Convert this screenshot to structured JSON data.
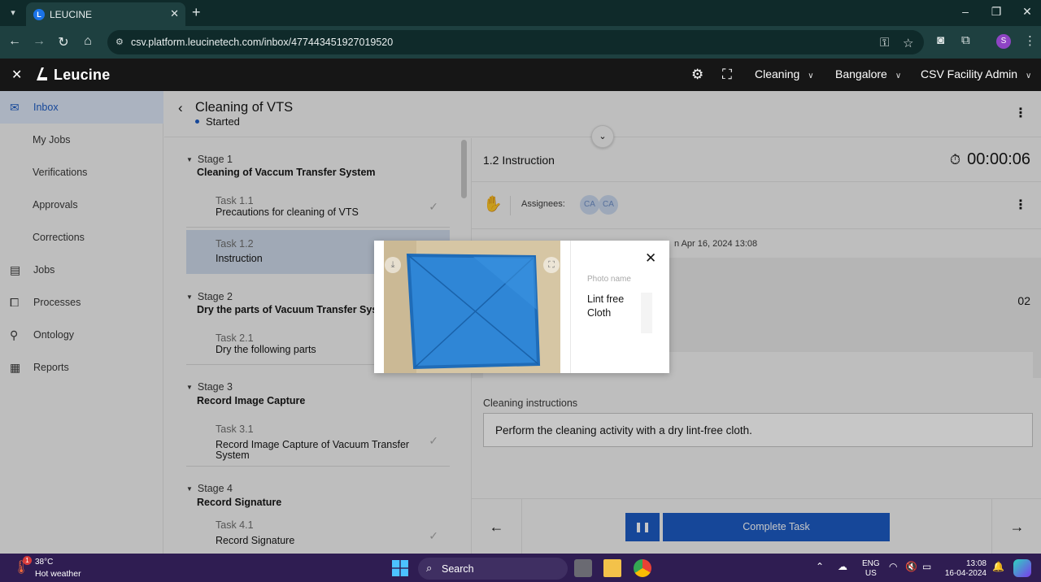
{
  "browser": {
    "tab_title": "LEUCINE",
    "url": "csv.platform.leucinetech.com/inbox/477443451927019520",
    "profile_initial": "S"
  },
  "app": {
    "brand": "Leucine",
    "facility_dropdown": "Cleaning",
    "location_dropdown": "Bangalore",
    "user_dropdown": "CSV Facility Admin"
  },
  "sidebar": {
    "items": [
      {
        "label": "Inbox",
        "icon": "inbox-icon"
      },
      {
        "label": "My Jobs"
      },
      {
        "label": "Verifications"
      },
      {
        "label": "Approvals"
      },
      {
        "label": "Corrections"
      },
      {
        "label": "Jobs",
        "icon": "clipboard-icon"
      },
      {
        "label": "Processes",
        "icon": "flow-icon"
      },
      {
        "label": "Ontology",
        "icon": "hierarchy-icon"
      },
      {
        "label": "Reports",
        "icon": "report-icon"
      }
    ]
  },
  "job": {
    "title": "Cleaning of VTS",
    "status": "Started"
  },
  "stages": [
    {
      "label": "Stage 1",
      "name": "Cleaning of Vaccum Transfer System",
      "tasks": [
        {
          "no": "Task 1.1",
          "name": "Precautions for cleaning of VTS"
        },
        {
          "no": "Task 1.2",
          "name": "Instruction"
        }
      ]
    },
    {
      "label": "Stage 2",
      "name": "Dry the parts of Vacuum Transfer Syste",
      "tasks": [
        {
          "no": "Task 2.1",
          "name": "Dry the following parts"
        }
      ]
    },
    {
      "label": "Stage 3",
      "name": "Record Image Capture",
      "tasks": [
        {
          "no": "Task 3.1",
          "name": "Record Image Capture of Vacuum Transfer System"
        }
      ]
    },
    {
      "label": "Stage 4",
      "name": "Record Signature",
      "tasks": [
        {
          "no": "Task 4.1",
          "name": "Record Signature"
        }
      ]
    }
  ],
  "task_panel": {
    "step_title": "1.2 Instruction",
    "timer": "00:00:06",
    "assignees_label": "Assignees:",
    "assignees": [
      "CA",
      "CA"
    ],
    "meta_text": "n Apr 16, 2024 13:08",
    "count": "02",
    "instructions_label": "Cleaning instructions",
    "instructions_text": "Perform the cleaning activity with a dry lint-free cloth.",
    "complete_label": "Complete Task"
  },
  "photo_modal": {
    "photo_name_label": "Photo name",
    "photo_name": "Lint free Cloth",
    "photo_color": "#2f86d6"
  },
  "taskbar": {
    "temp": "38°C",
    "weather": "Hot weather",
    "weather_badge": "1",
    "search_label": "Search",
    "lang_top": "ENG",
    "lang_bottom": "US",
    "time": "13:08",
    "date": "16-04-2024"
  }
}
